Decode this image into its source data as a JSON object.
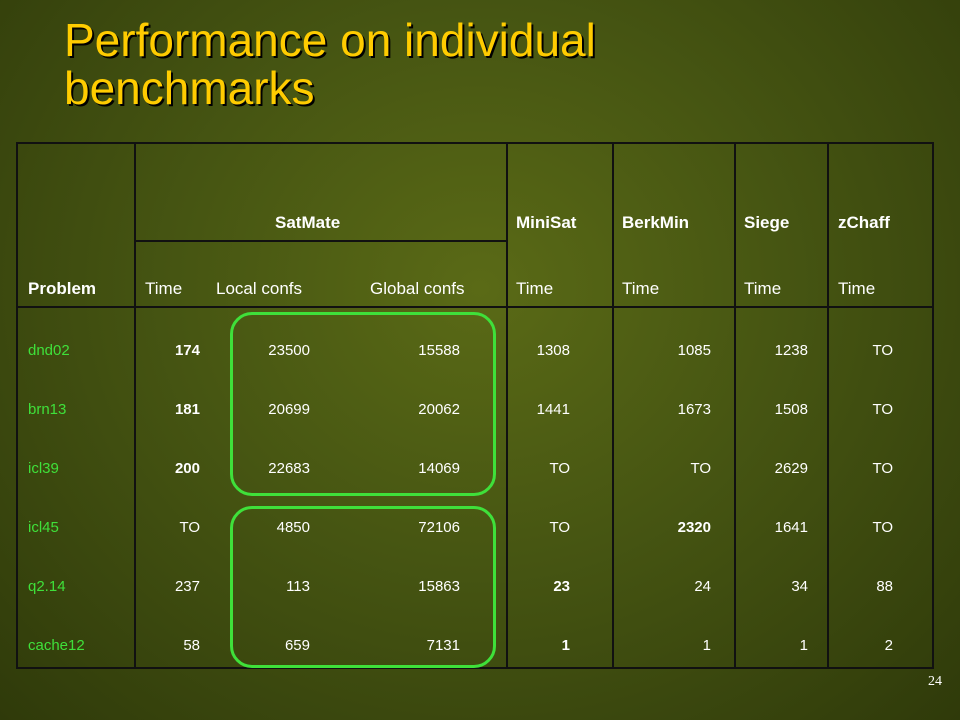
{
  "title": {
    "line1": "Performance on individual",
    "line2": "benchmarks"
  },
  "table": {
    "group_headers": {
      "satmate": "SatMate",
      "minisat": "MiniSat",
      "berkmin": "BerkMin",
      "siege": "Siege",
      "zchaff": "zChaff"
    },
    "sub_headers": {
      "problem": "Problem",
      "time": "Time",
      "local": "Local confs",
      "global": "Global confs",
      "minisat_time": "Time",
      "berkmin_time": "Time",
      "siege_time": "Time",
      "zchaff_time": "Time"
    },
    "rows": [
      {
        "problem": "dnd02",
        "satmate_time": "174",
        "local": "23500",
        "global": "15588",
        "minisat": "1308",
        "berkmin": "1085",
        "siege": "1238",
        "zchaff": "TO"
      },
      {
        "problem": "brn13",
        "satmate_time": "181",
        "local": "20699",
        "global": "20062",
        "minisat": "1441",
        "berkmin": "1673",
        "siege": "1508",
        "zchaff": "TO"
      },
      {
        "problem": "icl39",
        "satmate_time": "200",
        "local": "22683",
        "global": "14069",
        "minisat": "TO",
        "berkmin": "TO",
        "siege": "2629",
        "zchaff": "TO"
      },
      {
        "problem": "icl45",
        "satmate_time": "TO",
        "local": "4850",
        "global": "72106",
        "minisat": "TO",
        "berkmin": "2320",
        "siege": "1641",
        "zchaff": "TO"
      },
      {
        "problem": "q2.14",
        "satmate_time": "237",
        "local": "113",
        "global": "15863",
        "minisat": "23",
        "berkmin": "24",
        "siege": "34",
        "zchaff": "88"
      },
      {
        "problem": "cache12",
        "satmate_time": "58",
        "local": "659",
        "global": "7131",
        "minisat": "1",
        "berkmin": "1",
        "siege": "1",
        "zchaff": "2"
      }
    ]
  },
  "page_number": "24",
  "colors": {
    "title": "#ffcc00",
    "problem_text": "#3fe03a",
    "ring": "#3fe03a",
    "grid": "#111111",
    "background": "#4a5914"
  }
}
